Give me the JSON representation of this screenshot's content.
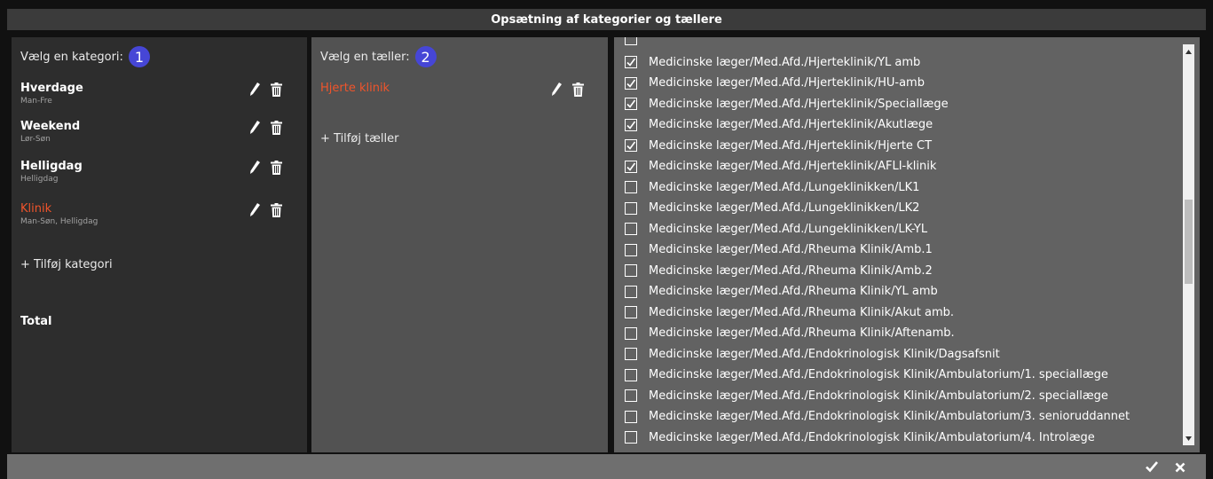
{
  "dialog": {
    "title": "Opsætning af kategorier og tællere"
  },
  "categories_panel": {
    "heading": "Vælg en kategori:",
    "step": "1",
    "items": [
      {
        "name": "Hverdage",
        "sub": "Man-Fre"
      },
      {
        "name": "Weekend",
        "sub": "Lør-Søn"
      },
      {
        "name": "Helligdag",
        "sub": "Helligdag"
      },
      {
        "name": "Klinik",
        "sub": "Man-Søn, Helligdag"
      }
    ],
    "active_index": 3,
    "add_label": "+ Tilføj kategori",
    "total_label": "Total"
  },
  "counters_panel": {
    "heading": "Vælg en tæller:",
    "step": "2",
    "items": [
      {
        "name": "Hjerte klinik"
      }
    ],
    "add_label": "+ Tilføj tæller"
  },
  "units_list": {
    "items": [
      {
        "label": "",
        "checked": false
      },
      {
        "label": "Medicinske læger/Med.Afd./Hjerteklinik/YL amb",
        "checked": true
      },
      {
        "label": "Medicinske læger/Med.Afd./Hjerteklinik/HU-amb",
        "checked": true
      },
      {
        "label": "Medicinske læger/Med.Afd./Hjerteklinik/Speciallæge",
        "checked": true
      },
      {
        "label": "Medicinske læger/Med.Afd./Hjerteklinik/Akutlæge",
        "checked": true
      },
      {
        "label": "Medicinske læger/Med.Afd./Hjerteklinik/Hjerte CT",
        "checked": true
      },
      {
        "label": "Medicinske læger/Med.Afd./Hjerteklinik/AFLI-klinik",
        "checked": true
      },
      {
        "label": "Medicinske læger/Med.Afd./Lungeklinikken/LK1",
        "checked": false
      },
      {
        "label": "Medicinske læger/Med.Afd./Lungeklinikken/LK2",
        "checked": false
      },
      {
        "label": "Medicinske læger/Med.Afd./Lungeklinikken/LK-YL",
        "checked": false
      },
      {
        "label": "Medicinske læger/Med.Afd./Rheuma Klinik/Amb.1",
        "checked": false
      },
      {
        "label": "Medicinske læger/Med.Afd./Rheuma Klinik/Amb.2",
        "checked": false
      },
      {
        "label": "Medicinske læger/Med.Afd./Rheuma Klinik/YL amb",
        "checked": false
      },
      {
        "label": "Medicinske læger/Med.Afd./Rheuma Klinik/Akut amb.",
        "checked": false
      },
      {
        "label": "Medicinske læger/Med.Afd./Rheuma Klinik/Aftenamb.",
        "checked": false
      },
      {
        "label": "Medicinske læger/Med.Afd./Endokrinologisk Klinik/Dagsafsnit",
        "checked": false
      },
      {
        "label": "Medicinske læger/Med.Afd./Endokrinologisk Klinik/Ambulatorium/1. speciallæge",
        "checked": false
      },
      {
        "label": "Medicinske læger/Med.Afd./Endokrinologisk Klinik/Ambulatorium/2. speciallæge",
        "checked": false
      },
      {
        "label": "Medicinske læger/Med.Afd./Endokrinologisk Klinik/Ambulatorium/3. senioruddannet",
        "checked": false
      },
      {
        "label": "Medicinske læger/Med.Afd./Endokrinologisk Klinik/Ambulatorium/4. Introlæge",
        "checked": false
      }
    ]
  },
  "colors": {
    "active": "#f0542b",
    "badge": "#4646d6"
  },
  "icons": {
    "edit": "pencil-icon",
    "delete": "trash-icon",
    "confirm": "checkmark-icon",
    "cancel": "close-icon"
  }
}
